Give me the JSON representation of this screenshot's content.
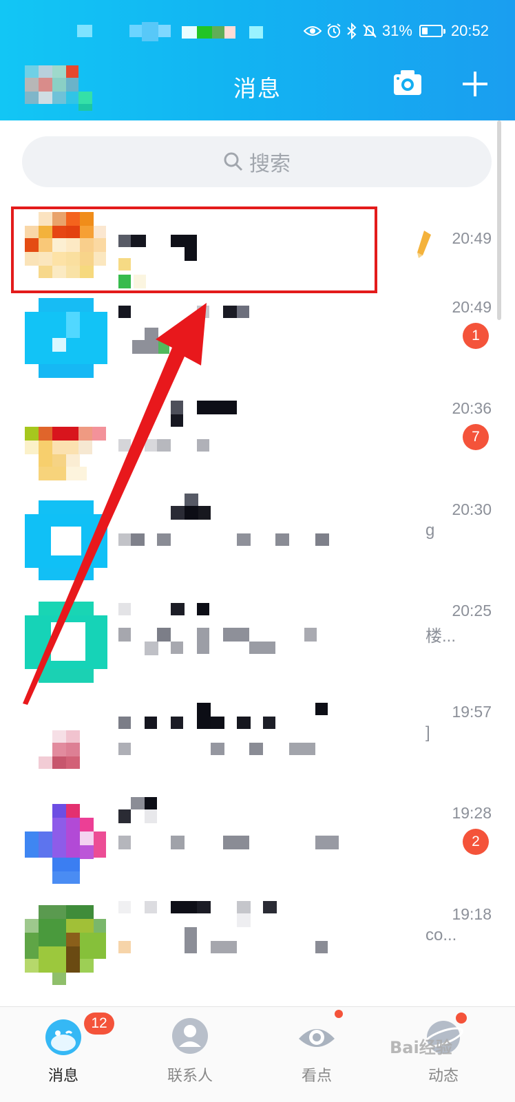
{
  "status_bar": {
    "battery": "31%",
    "clock": "20:52",
    "battery_level": 0.31
  },
  "header": {
    "title": "消息",
    "camera_icon": "camera-icon",
    "add_icon": "plus-icon",
    "accent": "#12b4f2"
  },
  "search": {
    "placeholder": "搜索"
  },
  "chats": [
    {
      "time": "20:49",
      "badge": "",
      "preview_tail": "",
      "pinned": true
    },
    {
      "time": "20:49",
      "badge": "1",
      "preview_tail": ""
    },
    {
      "time": "20:36",
      "badge": "7",
      "preview_tail": ""
    },
    {
      "time": "20:30",
      "badge": "",
      "preview_tail": "g"
    },
    {
      "time": "20:25",
      "badge": "",
      "preview_tail": "楼..."
    },
    {
      "time": "19:57",
      "badge": "",
      "preview_tail": "]"
    },
    {
      "time": "19:28",
      "badge": "2",
      "preview_tail": ""
    },
    {
      "time": "19:18",
      "badge": "",
      "preview_tail": "co..."
    }
  ],
  "tabbar": {
    "tabs": [
      {
        "label": "消息",
        "badge": "12"
      },
      {
        "label": "联系人"
      },
      {
        "label": "看点"
      },
      {
        "label": "动态"
      }
    ]
  },
  "watermark": "Bai经验",
  "colors": {
    "badge": "#f4533a",
    "highlight": "#e31b1b"
  }
}
